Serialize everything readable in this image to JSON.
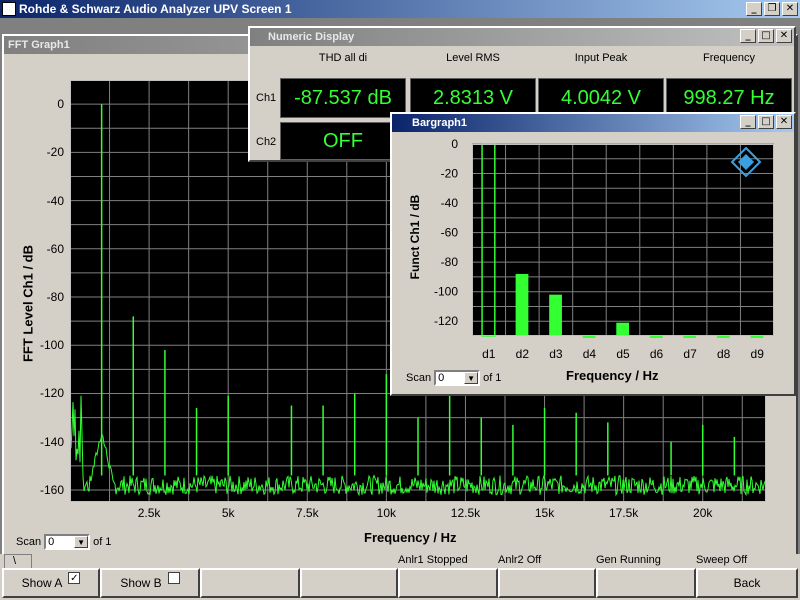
{
  "app": {
    "title": "Rohde & Schwarz Audio Analyzer UPV Screen 1"
  },
  "fft": {
    "window_title": "FFT Graph1",
    "ylabel": "FFT Level Ch1 / dB",
    "xlabel": "Frequency / Hz",
    "yticks": [
      "0",
      "-20",
      "-40",
      "-60",
      "-80",
      "-100",
      "-120",
      "-140",
      "-160"
    ],
    "xticks": [
      "2.5k",
      "5k",
      "7.5k",
      "10k",
      "12.5k",
      "15k",
      "17.5k",
      "20k"
    ],
    "scan_label": "Scan",
    "scan_value": "0",
    "scan_of": "of 1",
    "trace_color": "#33ff33"
  },
  "numeric": {
    "window_title": "Numeric Display",
    "columns": [
      "THD all di",
      "Level RMS",
      "Input Peak",
      "Frequency"
    ],
    "rows": [
      {
        "label": "Ch1",
        "values": [
          "-87.537 dB",
          "2.8313 V",
          "4.0042 V",
          "998.27 Hz"
        ]
      },
      {
        "label": "Ch2",
        "values": [
          "OFF"
        ]
      }
    ]
  },
  "bargraph": {
    "window_title": "Bargraph1",
    "ylabel": "Funct Ch1 / dB",
    "xlabel": "Frequency / Hz",
    "scan_label": "Scan",
    "scan_value": "0",
    "scan_of": "of 1"
  },
  "statusbar": {
    "tab_label": "\\",
    "status": [
      "Anlr1 Stopped",
      "Anlr2 Off",
      "Gen Running",
      "Sweep Off"
    ],
    "show_a_label": "Show A",
    "show_a_checked": "✓",
    "show_b_label": "Show B",
    "back_label": "Back"
  },
  "chart_data": [
    {
      "type": "line",
      "title": "",
      "xlabel": "Frequency / Hz",
      "ylabel": "FFT Level Ch1 / dB",
      "xlim": [
        0,
        22000
      ],
      "ylim": [
        -165,
        10
      ],
      "grid": true,
      "series": [
        {
          "peaks": [
            {
              "x": 1000,
              "y": 0
            },
            {
              "x": 2000,
              "y": -88
            },
            {
              "x": 3000,
              "y": -102
            },
            {
              "x": 4000,
              "y": -126
            },
            {
              "x": 5000,
              "y": -121
            },
            {
              "x": 7000,
              "y": -125
            },
            {
              "x": 8000,
              "y": -125
            },
            {
              "x": 9000,
              "y": -120
            },
            {
              "x": 10000,
              "y": -112
            },
            {
              "x": 11000,
              "y": -130
            },
            {
              "x": 12000,
              "y": -118
            },
            {
              "x": 13000,
              "y": -130
            },
            {
              "x": 14000,
              "y": -133
            },
            {
              "x": 15000,
              "y": -126
            },
            {
              "x": 16000,
              "y": -128
            },
            {
              "x": 17000,
              "y": -132
            },
            {
              "x": 19000,
              "y": -140
            },
            {
              "x": 20000,
              "y": -133
            },
            {
              "x": 21000,
              "y": -138
            }
          ],
          "noise_floor": -158
        }
      ]
    },
    {
      "type": "bar",
      "xlabel": "Frequency / Hz",
      "ylabel": "Funct Ch1 / dB",
      "ylim": [
        -130,
        0
      ],
      "categories": [
        "d1",
        "d2",
        "d3",
        "d4",
        "d5",
        "d6",
        "d7",
        "d8",
        "d9"
      ],
      "values": [
        0,
        -88,
        -102,
        -130,
        -121,
        -130,
        -130,
        -130,
        -130
      ],
      "yticks": [
        "0",
        "-20",
        "-40",
        "-60",
        "-80",
        "-100",
        "-120"
      ]
    }
  ]
}
